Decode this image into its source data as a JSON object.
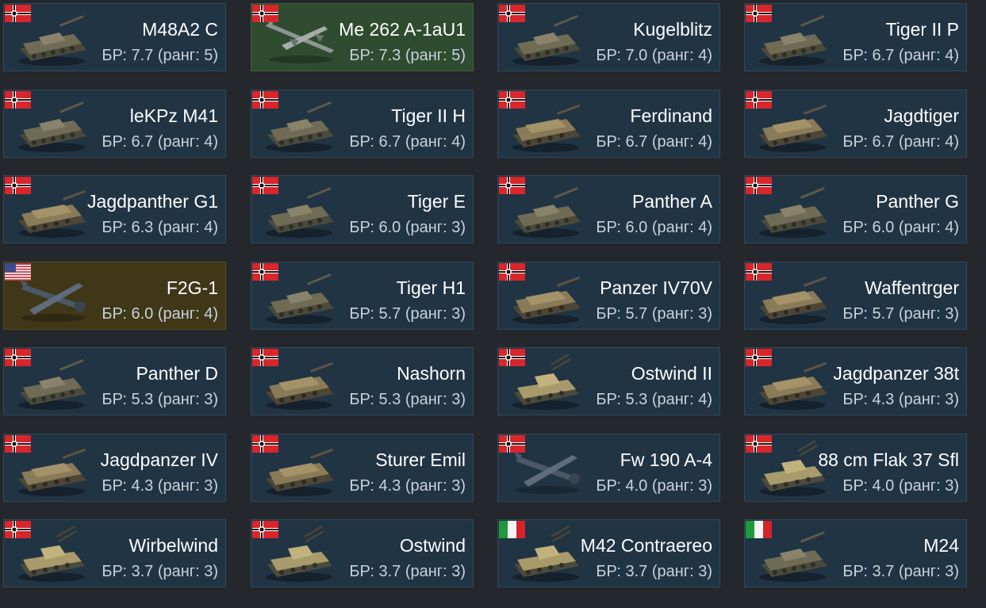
{
  "vehicles": [
    {
      "name": "M48A2 C",
      "br": "БР: 7.7 (ранг: 5)",
      "flag": "germany",
      "icon": "tank-icon",
      "bg": "ground"
    },
    {
      "name": "Me 262 A-1aU1",
      "br": "БР: 7.3 (ранг: 5)",
      "flag": "germany",
      "icon": "jet-plane-icon",
      "bg": "air"
    },
    {
      "name": "Kugelblitz",
      "br": "БР: 7.0 (ранг: 4)",
      "flag": "germany",
      "icon": "tank-icon",
      "bg": "ground"
    },
    {
      "name": "Tiger II P",
      "br": "БР: 6.7 (ранг: 4)",
      "flag": "germany",
      "icon": "tank-icon",
      "bg": "ground"
    },
    {
      "name": "leKPz M41",
      "br": "БР: 6.7 (ранг: 4)",
      "flag": "germany",
      "icon": "tank-icon",
      "bg": "ground"
    },
    {
      "name": "Tiger II H",
      "br": "БР: 6.7 (ранг: 4)",
      "flag": "germany",
      "icon": "tank-icon",
      "bg": "ground"
    },
    {
      "name": "Ferdinand",
      "br": "БР: 6.7 (ранг: 4)",
      "flag": "germany",
      "icon": "tank-destroyer-icon",
      "bg": "ground"
    },
    {
      "name": "Jagdtiger",
      "br": "БР: 6.7 (ранг: 4)",
      "flag": "germany",
      "icon": "tank-destroyer-icon",
      "bg": "ground"
    },
    {
      "name": "Jagdpanther G1",
      "br": "БР: 6.3 (ранг: 4)",
      "flag": "germany",
      "icon": "tank-destroyer-icon",
      "bg": "ground"
    },
    {
      "name": "Tiger E",
      "br": "БР: 6.0 (ранг: 3)",
      "flag": "germany",
      "icon": "tank-icon",
      "bg": "ground"
    },
    {
      "name": "Panther A",
      "br": "БР: 6.0 (ранг: 4)",
      "flag": "germany",
      "icon": "tank-icon",
      "bg": "ground"
    },
    {
      "name": "Panther G",
      "br": "БР: 6.0 (ранг: 4)",
      "flag": "germany",
      "icon": "tank-icon",
      "bg": "ground"
    },
    {
      "name": "F2G-1",
      "br": "БР: 6.0 (ранг: 4)",
      "flag": "usa",
      "icon": "prop-plane-icon",
      "bg": "premium"
    },
    {
      "name": "Tiger H1",
      "br": "БР: 5.7 (ранг: 3)",
      "flag": "germany",
      "icon": "tank-icon",
      "bg": "ground"
    },
    {
      "name": "Panzer IV70V",
      "br": "БР: 5.7 (ранг: 3)",
      "flag": "germany",
      "icon": "tank-destroyer-icon",
      "bg": "ground"
    },
    {
      "name": "Waffentrger",
      "br": "БР: 5.7 (ранг: 3)",
      "flag": "germany",
      "icon": "tank-destroyer-icon",
      "bg": "ground"
    },
    {
      "name": "Panther D",
      "br": "БР: 5.3 (ранг: 3)",
      "flag": "germany",
      "icon": "tank-icon",
      "bg": "ground"
    },
    {
      "name": "Nashorn",
      "br": "БР: 5.3 (ранг: 3)",
      "flag": "germany",
      "icon": "tank-destroyer-icon",
      "bg": "ground"
    },
    {
      "name": "Ostwind II",
      "br": "БР: 5.3 (ранг: 4)",
      "flag": "germany",
      "icon": "spaa-icon",
      "bg": "ground"
    },
    {
      "name": "Jagdpanzer 38t",
      "br": "БР: 4.3 (ранг: 3)",
      "flag": "germany",
      "icon": "tank-destroyer-icon",
      "bg": "ground"
    },
    {
      "name": "Jagdpanzer IV",
      "br": "БР: 4.3 (ранг: 3)",
      "flag": "germany",
      "icon": "tank-destroyer-icon",
      "bg": "ground"
    },
    {
      "name": "Sturer Emil",
      "br": "БР: 4.3 (ранг: 3)",
      "flag": "germany",
      "icon": "tank-destroyer-icon",
      "bg": "ground"
    },
    {
      "name": "Fw 190 A-4",
      "br": "БР: 4.0 (ранг: 3)",
      "flag": "germany",
      "icon": "prop-plane-icon",
      "bg": "ground"
    },
    {
      "name": "88 cm Flak 37 Sfl",
      "br": "БР: 4.0 (ранг: 3)",
      "flag": "germany",
      "icon": "spaa-icon",
      "bg": "ground"
    },
    {
      "name": "Wirbelwind",
      "br": "БР: 3.7 (ранг: 3)",
      "flag": "germany",
      "icon": "spaa-icon",
      "bg": "ground"
    },
    {
      "name": "Ostwind",
      "br": "БР: 3.7 (ранг: 3)",
      "flag": "germany",
      "icon": "spaa-icon",
      "bg": "ground"
    },
    {
      "name": "M42 Contraereo",
      "br": "БР: 3.7 (ранг: 3)",
      "flag": "italy",
      "icon": "spaa-icon",
      "bg": "ground"
    },
    {
      "name": "M24",
      "br": "БР: 3.7 (ранг: 3)",
      "flag": "italy",
      "icon": "tank-icon",
      "bg": "ground"
    }
  ],
  "colors": {
    "card_ground": "#213444",
    "card_air": "#2f4b30",
    "card_premium": "#3f3718",
    "page_bg": "#24272b"
  }
}
